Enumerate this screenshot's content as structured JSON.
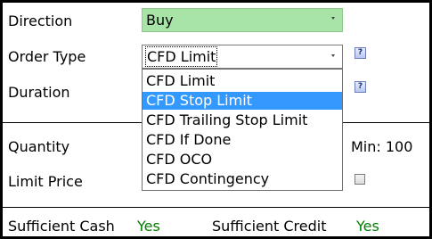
{
  "form": {
    "direction_label": "Direction",
    "direction_value": "Buy",
    "order_type_label": "Order Type",
    "order_type_value": "CFD Limit",
    "duration_label": "Duration",
    "quantity_label": "Quantity",
    "quantity_min": "Min: 100",
    "limit_price_label": "Limit Price",
    "help_glyph": "?"
  },
  "dropdown": {
    "options": [
      "CFD Limit",
      "CFD Stop Limit",
      "CFD Trailing Stop Limit",
      "CFD If Done",
      "CFD OCO",
      "CFD Contingency"
    ],
    "selected_index": 1
  },
  "footer": {
    "cash_label": "Sufficient Cash",
    "cash_value": "Yes",
    "credit_label": "Sufficient Credit",
    "credit_value": "Yes"
  },
  "colors": {
    "direction_bg": "#a8e4a8",
    "selection": "#3399ff",
    "yes": "#008000"
  }
}
